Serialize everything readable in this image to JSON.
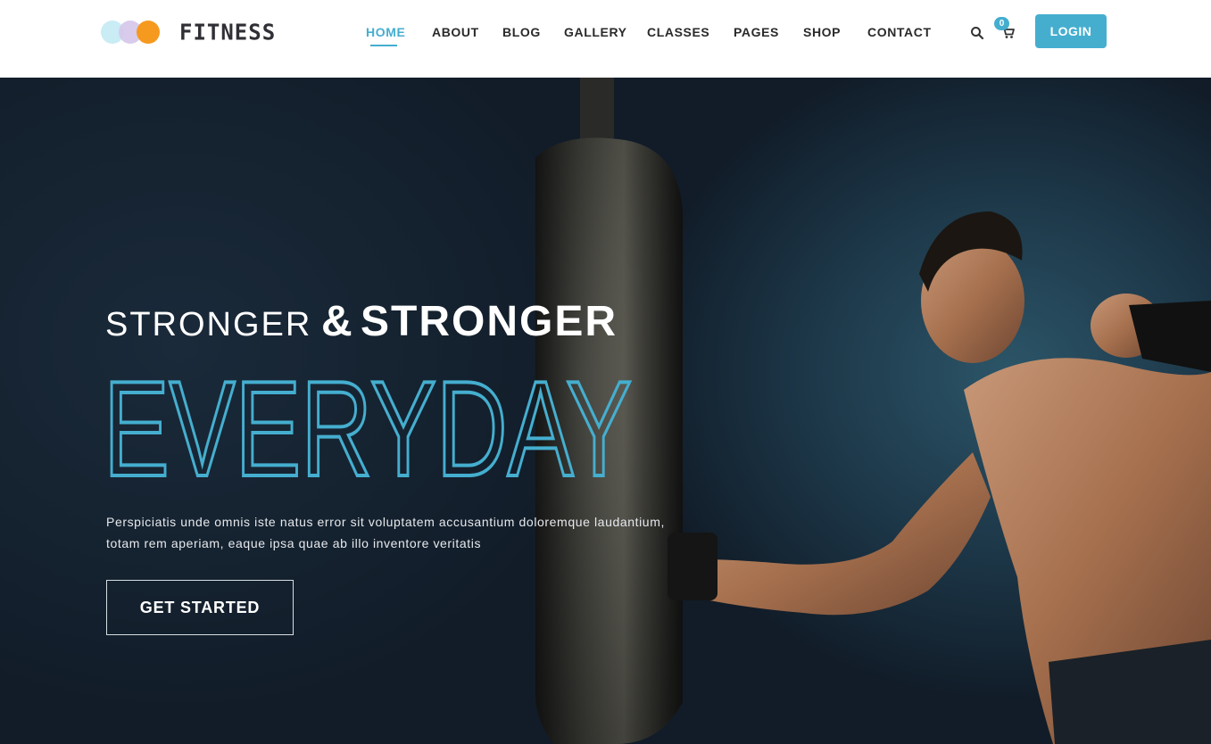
{
  "brand": {
    "name": "FITNESS",
    "accent_color": "#45aecf",
    "logo_dot_colors": [
      "#c9ecf5",
      "#d7c8ea",
      "#f59a1f"
    ]
  },
  "nav": {
    "items": [
      {
        "label": "HOME",
        "active": true
      },
      {
        "label": "ABOUT",
        "active": false
      },
      {
        "label": "BLOG",
        "active": false
      },
      {
        "label": "GALLERY",
        "active": false
      },
      {
        "label": "CLASSES",
        "active": false
      },
      {
        "label": "PAGES",
        "active": false
      },
      {
        "label": "SHOP",
        "active": false
      },
      {
        "label": "CONTACT",
        "active": false
      }
    ],
    "search_icon": "search-icon",
    "cart_icon": "cart-icon",
    "cart_count": "0",
    "login_label": "LOGIN"
  },
  "hero": {
    "headline_small": "STRONGER",
    "headline_amp": "&",
    "headline_big": "STRONGER",
    "headline_accent": "EVERYDAY",
    "description_line1": "Perspiciatis unde omnis iste natus error sit voluptatem accusantium doloremque laudantium,",
    "description_line2": "totam rem aperiam, eaque ipsa quae ab illo inventore veritatis",
    "cta_label": "GET STARTED"
  }
}
